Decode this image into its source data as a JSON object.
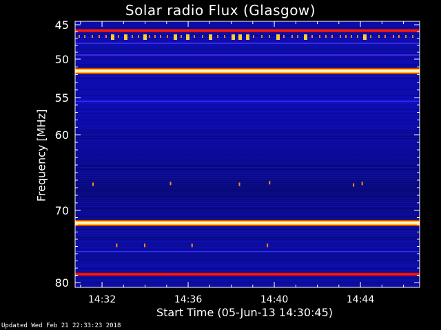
{
  "chart_data": {
    "type": "heatmap",
    "title": "Solar radio Flux (Glasgow)",
    "xlabel": "Start Time (05-Jun-13 14:30:45)",
    "ylabel": "Frequency [MHz]",
    "x_range_minutes": [
      0,
      16
    ],
    "x_ticks": [
      {
        "label": "14:32",
        "minute": 1.25
      },
      {
        "label": "14:36",
        "minute": 5.25
      },
      {
        "label": "14:40",
        "minute": 9.25
      },
      {
        "label": "14:44",
        "minute": 13.25
      }
    ],
    "y_range_mhz": [
      45,
      81
    ],
    "y_ticks": [
      45,
      50,
      55,
      60,
      70,
      80
    ],
    "interference_bands_mhz": [
      {
        "freq": 45.8,
        "intensity": "high",
        "color": "#ff1a00"
      },
      {
        "freq": 51.5,
        "intensity": "very-high",
        "color": "#ffffd0"
      },
      {
        "freq": 71.7,
        "intensity": "very-high",
        "color": "#ffffd0"
      },
      {
        "freq": 78.8,
        "intensity": "high",
        "color": "#ff1a00"
      },
      {
        "freq": 55.5,
        "intensity": "low",
        "color": "#2a2aff"
      },
      {
        "freq": 47.7,
        "intensity": "low",
        "color": "#3a2ae0"
      },
      {
        "freq": 49.4,
        "intensity": "low",
        "color": "#3a2ae0"
      },
      {
        "freq": 75.7,
        "intensity": "low",
        "color": "#2a2aff"
      }
    ],
    "colorscale": [
      "#000033",
      "#0a0aa0",
      "#1a1ad8",
      "#ff1a00",
      "#ffcc00",
      "#ffffd0"
    ]
  },
  "footer": {
    "updated": "Updated Wed Feb 21 22:33:23 2018"
  }
}
